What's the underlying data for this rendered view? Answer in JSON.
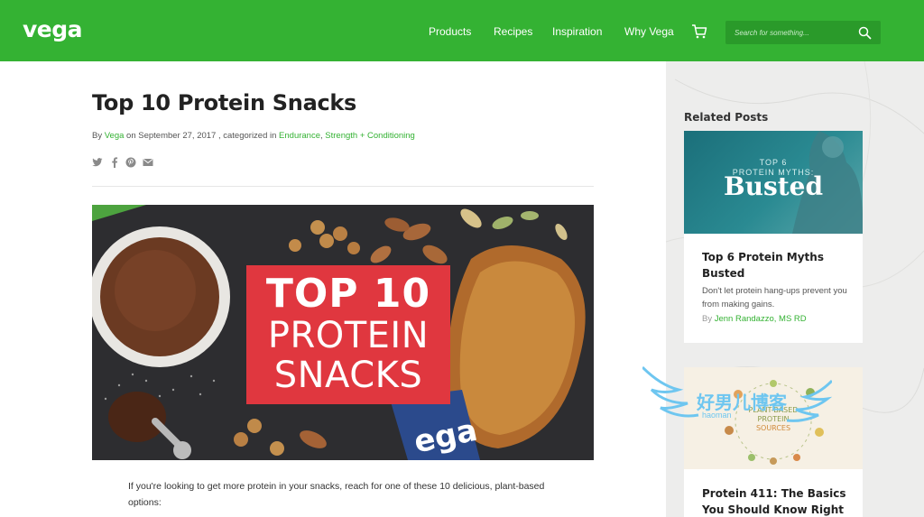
{
  "header": {
    "logo": "vega",
    "nav": [
      "Products",
      "Recipes",
      "Inspiration",
      "Why Vega"
    ],
    "search_placeholder": "Search for something...",
    "brand_color": "#34b233"
  },
  "article": {
    "title": "Top 10 Protein Snacks",
    "byline": {
      "by": "By ",
      "author": "Vega",
      "on_date": " on September 27, 2017 , categorized in ",
      "category1": "Endurance",
      "sep": ", ",
      "category2": "Strength + Conditioning"
    },
    "share_icons": [
      "twitter-icon",
      "facebook-icon",
      "pinterest-icon",
      "email-icon"
    ],
    "hero": {
      "line1": "TOP 10",
      "line2": "PROTEIN",
      "line3": "SNACKS"
    },
    "intro": "If you're looking to get more protein in your snacks, reach for one of these 10 delicious, plant-based options:"
  },
  "sidebar": {
    "heading": "Related Posts",
    "posts": [
      {
        "image_small_text": "TOP 6\nPROTEIN MYTHS:",
        "image_big_text": "Busted",
        "title": "Top 6 Protein Myths Busted",
        "excerpt": "Don't let protein hang-ups prevent you from making gains.",
        "by": "By ",
        "author": "Jenn Randazzo, MS RD"
      },
      {
        "title": "Protein 411: The Basics You Should Know Right"
      }
    ]
  },
  "watermark": {
    "text": "好男儿博客",
    "sub": "haoman"
  }
}
